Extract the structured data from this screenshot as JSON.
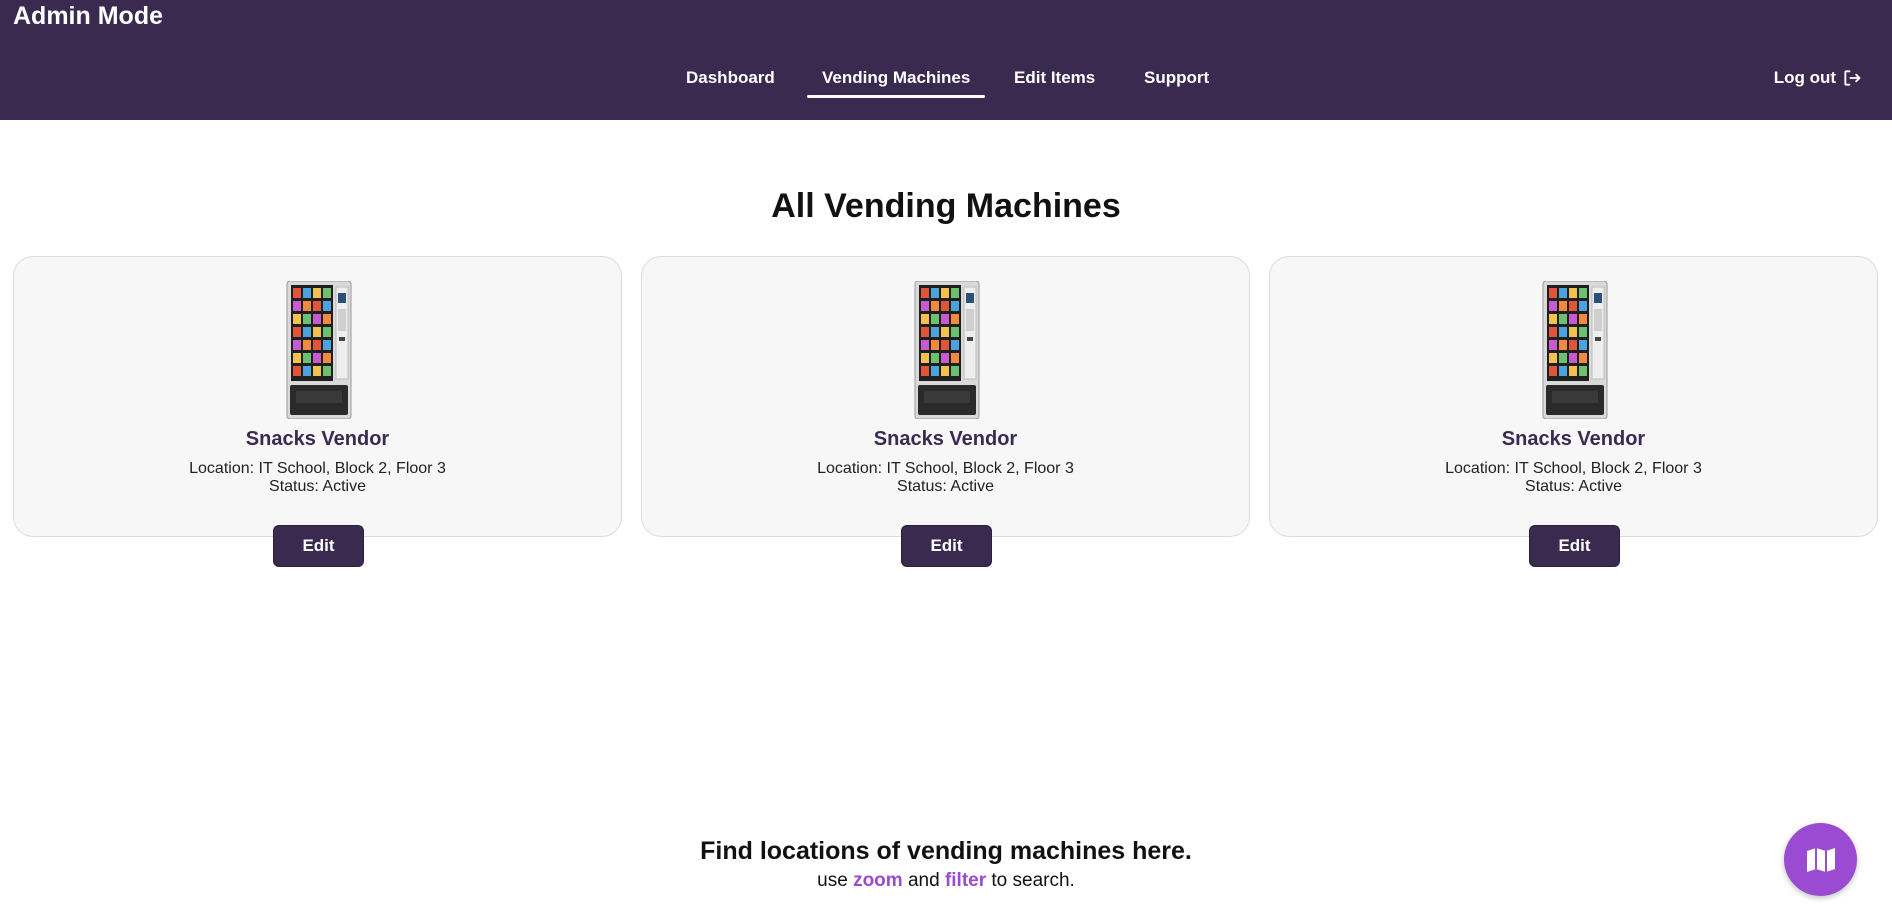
{
  "header": {
    "brand": "Admin Mode",
    "nav": [
      {
        "label": "Dashboard",
        "active": false
      },
      {
        "label": "Vending Machines",
        "active": true
      },
      {
        "label": "Edit Items",
        "active": false
      },
      {
        "label": "Support",
        "active": false
      }
    ],
    "logout_label": "Log out",
    "logout_icon": "logout-icon"
  },
  "main": {
    "title": "All Vending Machines",
    "machines": [
      {
        "name": "Snacks Vendor",
        "location": "Location: IT School, Block 2, Floor 3",
        "status": "Status: Active",
        "edit_label": "Edit",
        "image_icon": "vending-machine-icon"
      },
      {
        "name": "Snacks Vendor",
        "location": "Location: IT School, Block 2, Floor 3",
        "status": "Status: Active",
        "edit_label": "Edit",
        "image_icon": "vending-machine-icon"
      },
      {
        "name": "Snacks Vendor",
        "location": "Location: IT School, Block 2, Floor 3",
        "status": "Status: Active",
        "edit_label": "Edit",
        "image_icon": "vending-machine-icon"
      }
    ]
  },
  "finder": {
    "title": "Find locations of vending machines here.",
    "sub_prefix": "use",
    "sub_zoom": "zoom",
    "sub_and": "and",
    "sub_filter": "filter",
    "sub_suffix": "to search.",
    "fab_icon": "map-icon"
  },
  "colors": {
    "header_bg": "#3b2a4f",
    "accent": "#9b4bd1",
    "card_bg": "#f7f7f7",
    "button_bg": "#3b2a4f"
  }
}
